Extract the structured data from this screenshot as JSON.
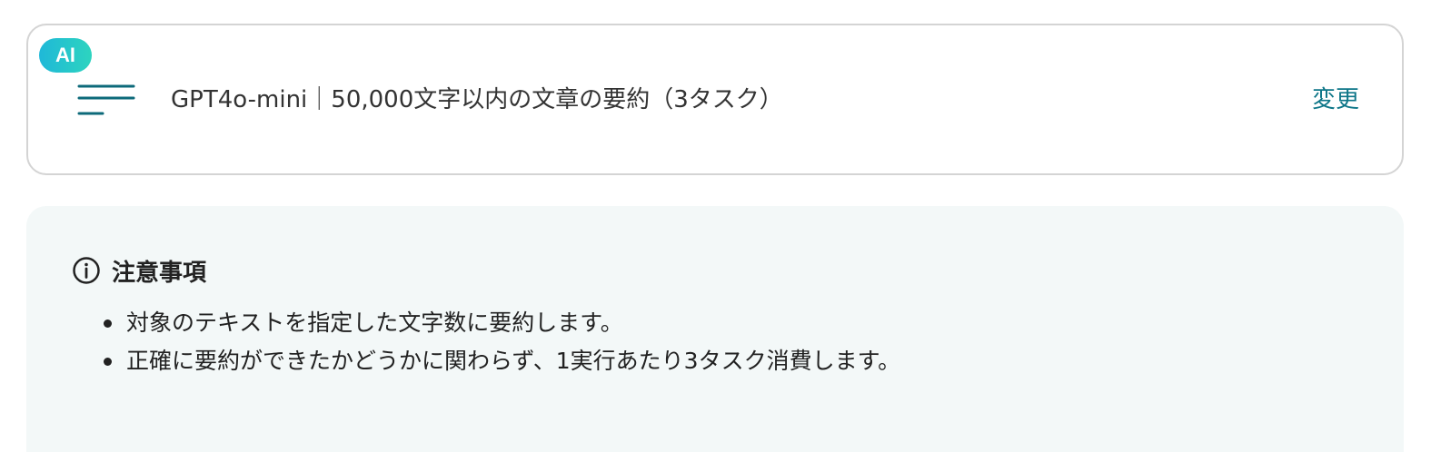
{
  "action_card": {
    "badge": "AI",
    "icon": "menu-lines-icon",
    "title": "GPT4o-mini｜50,000文字以内の文章の要約（3タスク）",
    "change_label": "変更",
    "accent_color": "#0d7688",
    "badge_gradient": [
      "#1fb8d8",
      "#2dd4bf"
    ]
  },
  "notice": {
    "icon": "info-circle-icon",
    "title": "注意事項",
    "items": [
      {
        "text": "対象のテキストを指定した文字数に要約します。"
      },
      {
        "text": "正確に要約ができたかどうかに関わらず、1実行あたり3タスク消費します。"
      }
    ],
    "background_color": "#f3f8f8"
  }
}
